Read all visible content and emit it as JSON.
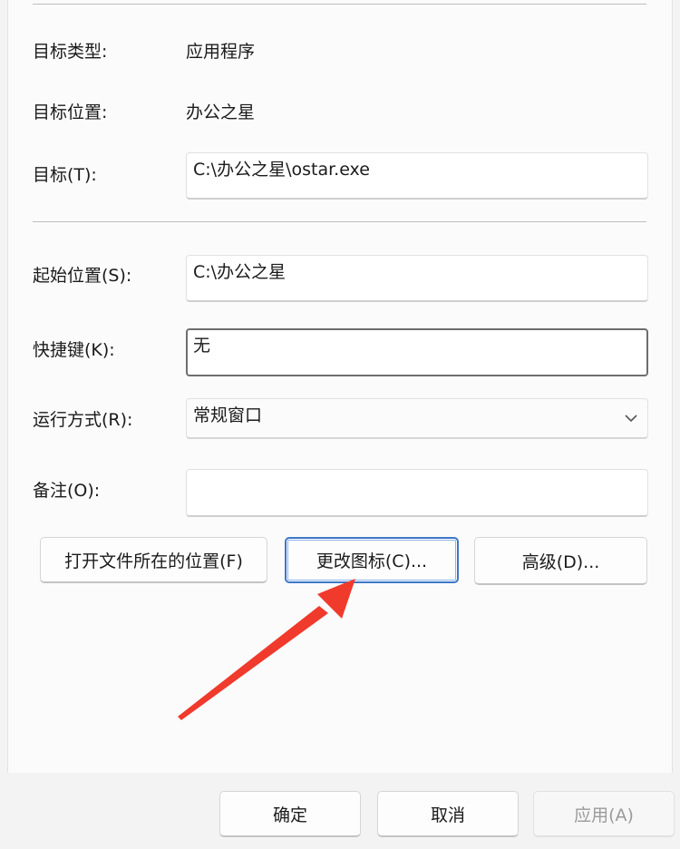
{
  "fields": {
    "target_type": {
      "label": "目标类型:",
      "value": "应用程序"
    },
    "target_location": {
      "label": "目标位置:",
      "value": "办公之星"
    },
    "target": {
      "label": "目标(T):",
      "value": "C:\\办公之星\\ostar.exe"
    },
    "start_in": {
      "label": "起始位置(S):",
      "value": "C:\\办公之星"
    },
    "shortcut_key": {
      "label": "快捷键(K):",
      "value": "无"
    },
    "run": {
      "label": "运行方式(R):",
      "value": "常规窗口"
    },
    "comment": {
      "label": "备注(O):",
      "value": ""
    }
  },
  "action_buttons": {
    "open_location": "打开文件所在的位置(F)",
    "change_icon": "更改图标(C)...",
    "advanced": "高级(D)..."
  },
  "footer_buttons": {
    "ok": "确定",
    "cancel": "取消",
    "apply": "应用(A)"
  },
  "colors": {
    "annotation_arrow": "#f03a2c",
    "focus_border": "#3d77c9"
  },
  "icons": [
    "chevron-down-icon",
    "annotation-arrow"
  ]
}
